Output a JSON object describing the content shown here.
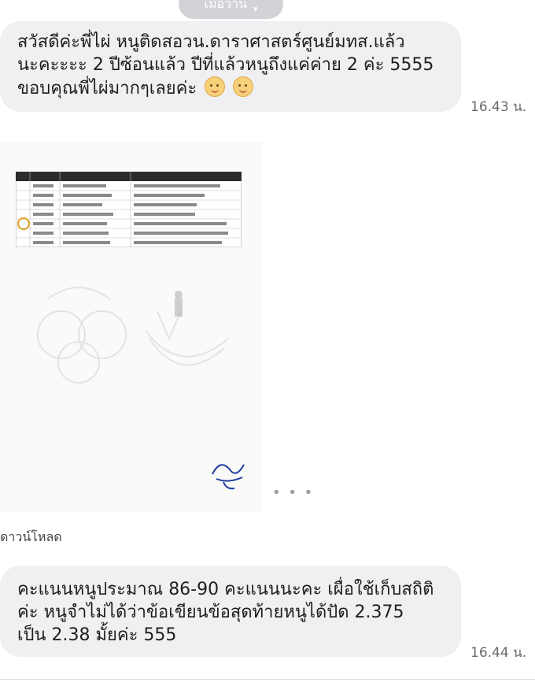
{
  "date_separator": {
    "label": "เมื่อวาน",
    "chevron": "▾"
  },
  "messages": [
    {
      "lines": [
        "สวัสดีค่ะพี่ไผ่ หนูติดสอวน.ดาราศาสตร์ศูนย์มทส.แล้ว",
        "นะคะะะะ 2 ปีซ้อนแล้ว ปีที่แล้วหนูถึงแค่ค่าย 2 ค่ะ 5555",
        "ขอบคุณพี่ไผ่มากๆเลยค่ะ"
      ],
      "emojis": [
        "smiling-face-icon",
        "smiling-face-icon"
      ],
      "time": "16.43 น."
    },
    {
      "lines": [
        "คะแนนหนูประมาณ 86-90 คะแนนนะคะ เผื่อใช้เก็บสถิติ",
        "ค่ะ หนูจำไม่ได้ว่าข้อเขียนข้อสุดท้ายหนูได้ปัด 2.375",
        "เป็น 2.38 มั้ยค่ะ 555"
      ],
      "time": "16.44 น."
    }
  ],
  "image_attachment": {
    "more_label": "• • •",
    "download_label": "ดาวน์โหลด"
  }
}
